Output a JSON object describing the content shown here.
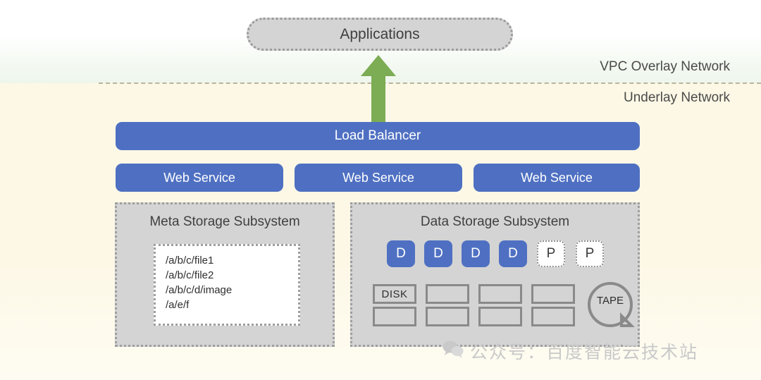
{
  "diagram": {
    "applications": {
      "label": "Applications"
    },
    "network_labels": {
      "overlay": "VPC Overlay Network",
      "underlay": "Underlay Network"
    },
    "load_balancer": {
      "label": "Load Balancer"
    },
    "web_services": [
      {
        "label": "Web Service"
      },
      {
        "label": "Web Service"
      },
      {
        "label": "Web Service"
      }
    ],
    "meta_storage": {
      "title": "Meta Storage Subsystem",
      "files": [
        "/a/b/c/file1",
        "/a/b/c/file2",
        "/a/b/c/d/image",
        "/a/e/f"
      ]
    },
    "data_storage": {
      "title": "Data Storage Subsystem",
      "nodes": [
        {
          "label": "D",
          "type": "data"
        },
        {
          "label": "D",
          "type": "data"
        },
        {
          "label": "D",
          "type": "data"
        },
        {
          "label": "D",
          "type": "data"
        },
        {
          "label": "P",
          "type": "placeholder"
        },
        {
          "label": "P",
          "type": "placeholder"
        }
      ],
      "disk_columns": [
        {
          "cells": [
            "DISK",
            ""
          ]
        },
        {
          "cells": [
            "",
            ""
          ]
        },
        {
          "cells": [
            "",
            ""
          ]
        },
        {
          "cells": [
            "",
            ""
          ]
        }
      ],
      "tape": {
        "label": "TAPE"
      }
    },
    "watermark": {
      "text": "公众号：百度智能云技术站",
      "icon": "wechat-icon"
    },
    "colors": {
      "blue": "#4f70c2",
      "green_arrow": "#7cac53",
      "panel_gray": "#d4d4d4",
      "overlay_band": "#eef6ec",
      "underlay_band": "#fdf8e6",
      "divider": "#b9b49c"
    }
  }
}
